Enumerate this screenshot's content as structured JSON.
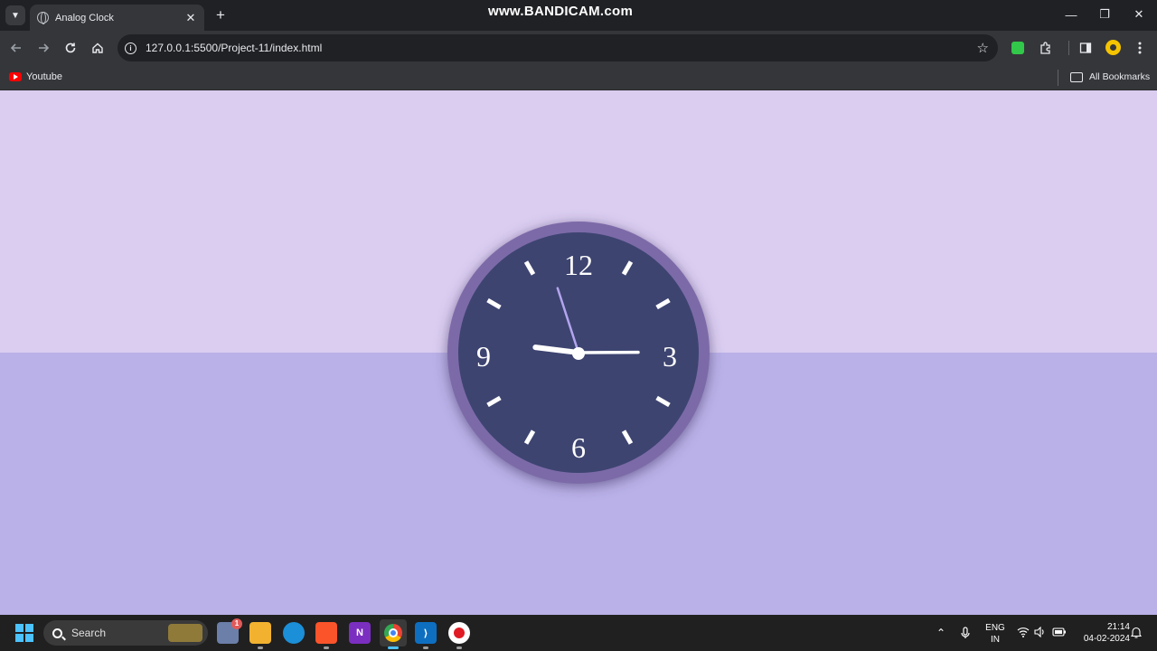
{
  "browser": {
    "tab_title": "Analog Clock",
    "tab_close": "✕",
    "new_tab": "+",
    "watermark": "www.BANDICAM.com",
    "window_controls": {
      "minimize": "—",
      "restore": "❐",
      "close": "✕"
    },
    "url": "127.0.0.1:5500/Project-11/index.html",
    "bookmark_star": "☆",
    "bookmarks": {
      "youtube": "Youtube",
      "all_bookmarks": "All Bookmarks"
    }
  },
  "clock": {
    "numbers": {
      "twelve": "12",
      "three": "3",
      "six": "6",
      "nine": "9"
    },
    "time": {
      "hours": 9,
      "minutes": 14,
      "seconds": 57
    },
    "colors": {
      "face": "#3d4470",
      "rim": "#7b6aa8",
      "second_hand": "#b3a4ee",
      "hands": "#ffffff",
      "bg_top": "#dacdf0",
      "bg_bottom": "#b9b1e7"
    }
  },
  "taskbar": {
    "search_label": "Search",
    "weather_badge": "1",
    "language": "ENG",
    "region": "IN",
    "time": "21:14",
    "date": "04-02-2024"
  }
}
